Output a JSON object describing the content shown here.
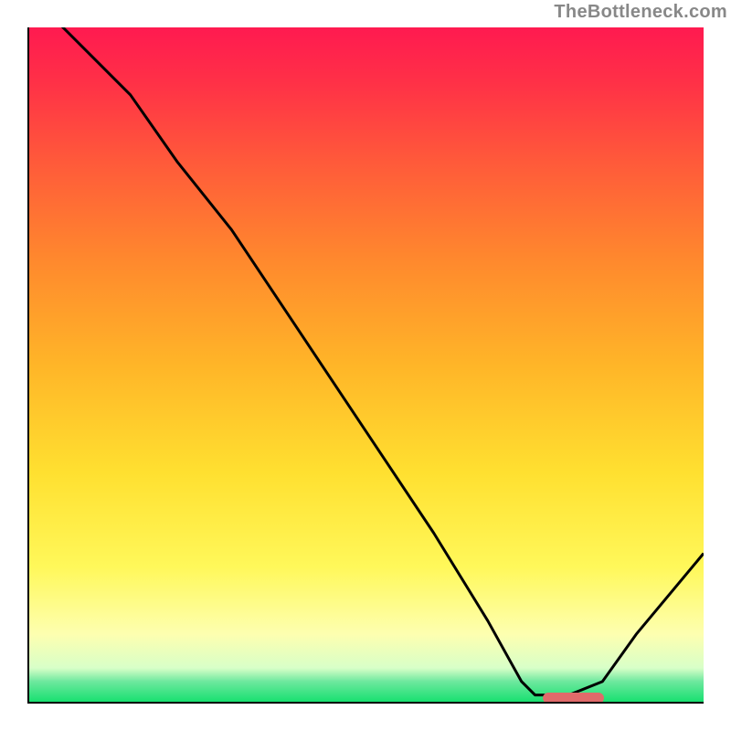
{
  "watermark": "TheBottleneck.com",
  "chart_data": {
    "type": "line",
    "title": "",
    "xlabel": "",
    "ylabel": "",
    "xlim": [
      0,
      100
    ],
    "ylim": [
      0,
      100
    ],
    "grid": false,
    "series": [
      {
        "name": "curve",
        "x": [
          0,
          5,
          15,
          22,
          30,
          40,
          50,
          60,
          68,
          73,
          75,
          80,
          85,
          90,
          100
        ],
        "y": [
          105,
          100,
          90,
          80,
          70,
          55,
          40,
          25,
          12,
          3,
          1,
          1,
          3,
          10,
          22
        ]
      }
    ],
    "marker": {
      "x_start": 76,
      "x_end": 85,
      "y": 0.8
    },
    "colors": {
      "curve": "#000000",
      "marker": "#e06a6a",
      "gradient_top": "#ff1a50",
      "gradient_bottom": "#18e070"
    }
  }
}
